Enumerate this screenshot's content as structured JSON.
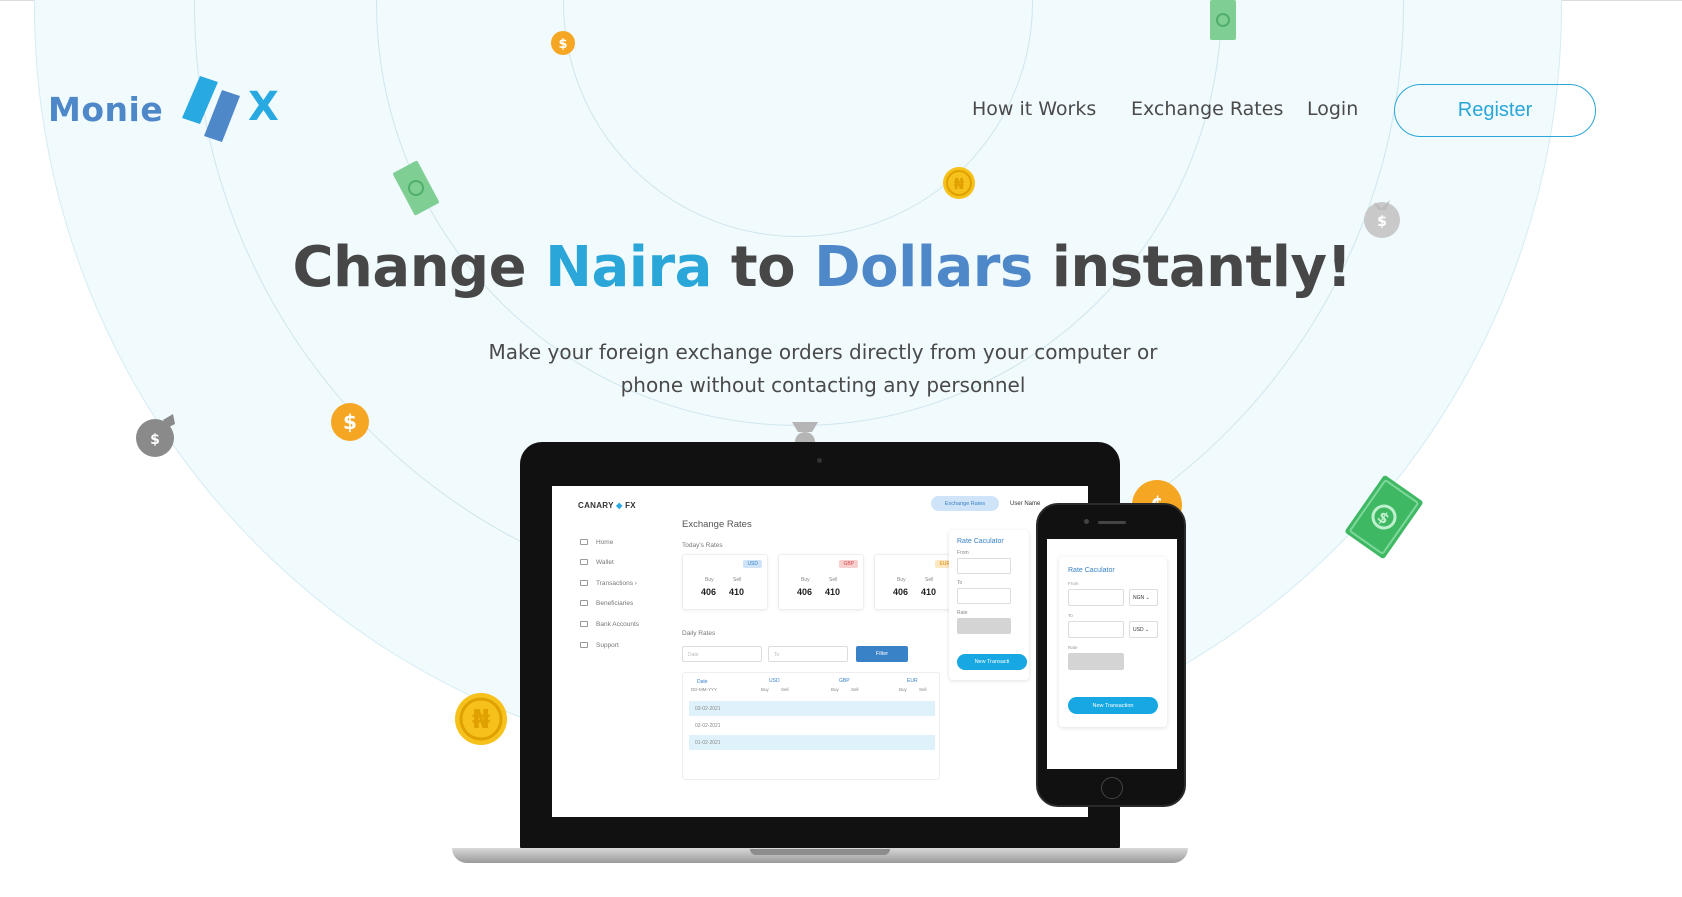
{
  "brand": {
    "name_left": "Monie",
    "name_right": "X",
    "primary_color": "#4e88c9",
    "accent_color": "#2aa6d8"
  },
  "nav": {
    "links": [
      {
        "label": "How it Works"
      },
      {
        "label": "Exchange Rates"
      },
      {
        "label": "Login"
      }
    ],
    "register_label": "Register"
  },
  "hero": {
    "title_part1": "Change ",
    "title_highlight1": "Naira",
    "title_part2": " to ",
    "title_highlight2": "Dollars",
    "title_part3": " instantly!",
    "subtitle_line1": "Make your foreign exchange orders directly from your computer or",
    "subtitle_line2": "phone without contacting any personnel"
  },
  "laptop_app": {
    "logo_left": "CANARY",
    "logo_right": "FX",
    "active_tab": "Exchange Rates",
    "user_name": "User Name",
    "sidebar": [
      "Home",
      "Wallet",
      "Transactions",
      "Beneficiaries",
      "Bank Accounts",
      "Support"
    ],
    "page_title": "Exchange Rates",
    "todays_rates_label": "Today's Rates",
    "rate_cards": [
      {
        "currency": "USD",
        "buy_label": "Buy",
        "sell_label": "Sell",
        "buy": "406",
        "sell": "410"
      },
      {
        "currency": "GBP",
        "buy_label": "Buy",
        "sell_label": "Sell",
        "buy": "406",
        "sell": "410"
      },
      {
        "currency": "EUR",
        "buy_label": "Buy",
        "sell_label": "Sell",
        "buy": "406",
        "sell": "410"
      }
    ],
    "daily_rates_label": "Daily Rates",
    "from_placeholder": "Date",
    "to_placeholder": "To",
    "filter_label": "Filter",
    "table": {
      "date_header": "Date",
      "date_format": "DD-MM-YYY",
      "currencies": [
        "USD",
        "GBP",
        "EUR"
      ],
      "buy_label": "Buy",
      "sell_label": "Sell",
      "rows": [
        "03-02-2021",
        "02-02-2021",
        "01-02-2021"
      ]
    },
    "calculator": {
      "title": "Rate Caculator",
      "from_label": "From",
      "to_label": "To",
      "rate_label": "Rate",
      "button_label": "New Transacti"
    }
  },
  "phone_app": {
    "title": "Rate Caculator",
    "from_label": "From",
    "from_currency": "NGN",
    "to_label": "To",
    "to_currency": "USD",
    "rate_label": "Rate",
    "button_label": "New Transaction"
  }
}
